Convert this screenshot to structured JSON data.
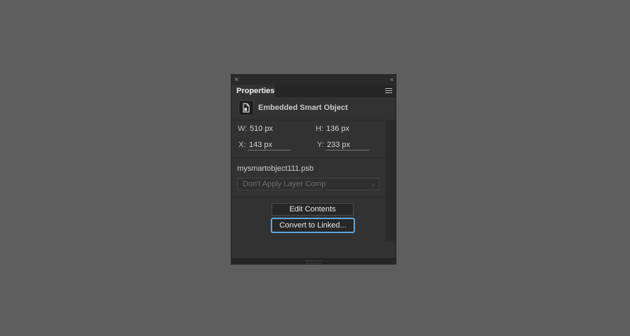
{
  "panel": {
    "tab_label": "Properties",
    "close_glyph": "×",
    "collapse_glyph": "‹‹",
    "header_title": "Embedded Smart Object",
    "icon": "smart-object-icon",
    "fields": {
      "w_label": "W:",
      "w_value": "510 px",
      "h_label": "H:",
      "h_value": "136 px",
      "x_label": "X:",
      "x_value": "143 px",
      "y_label": "Y:",
      "y_value": "233 px"
    },
    "filename": "mysmartobject111.psb",
    "layer_comp": {
      "selected": "Don't Apply Layer Comp"
    },
    "buttons": {
      "edit_contents": "Edit Contents",
      "convert_linked": "Convert to Linked..."
    }
  },
  "colors": {
    "background": "#5e5e5e",
    "panel": "#323232",
    "focus_ring": "#5fa7dd"
  }
}
